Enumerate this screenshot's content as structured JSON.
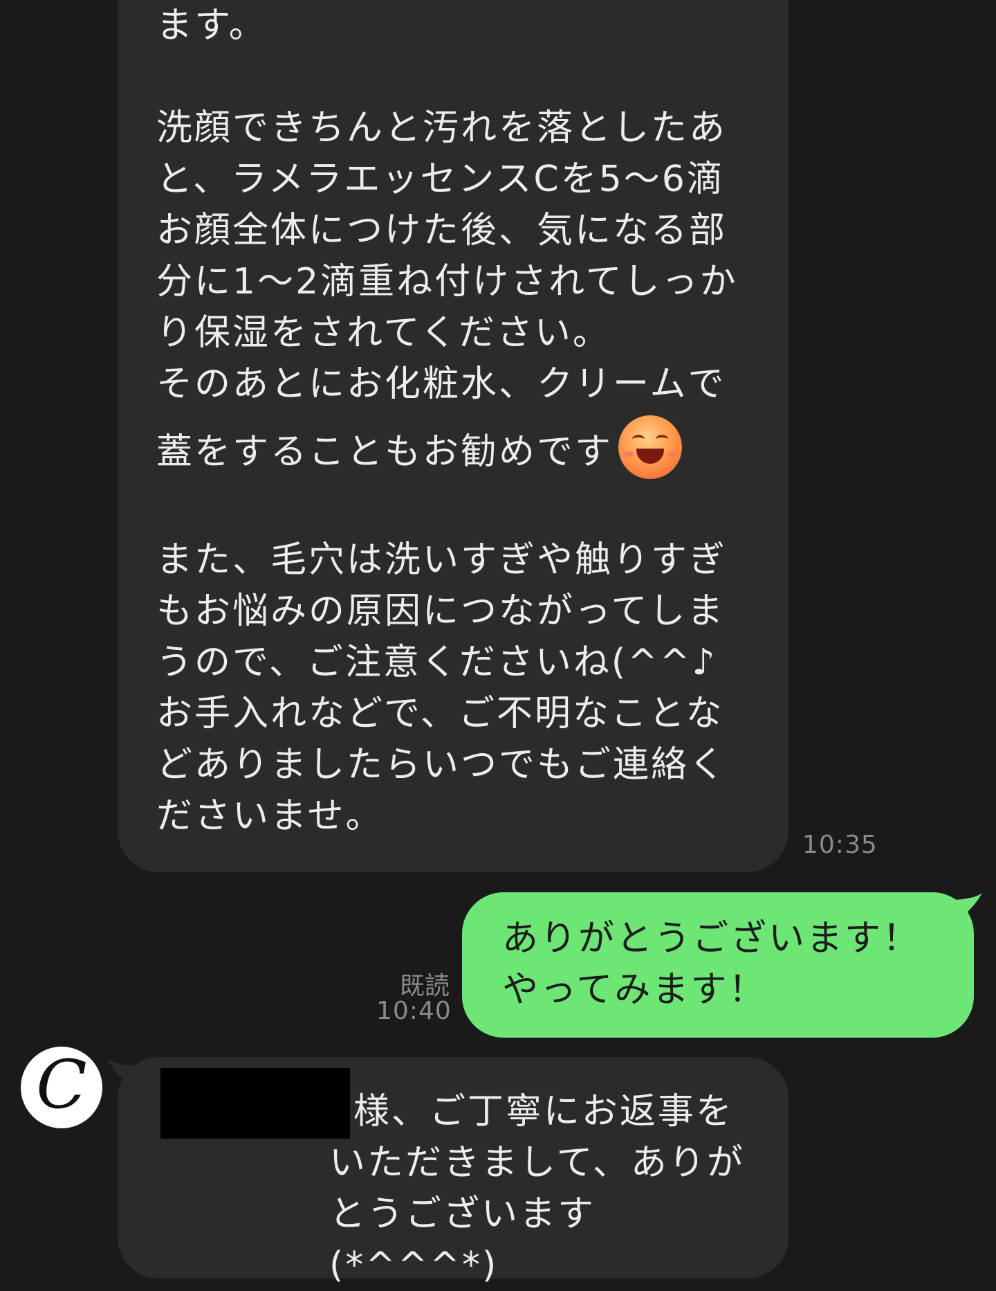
{
  "messages": [
    {
      "side": "in",
      "paragraphs": [
        "ます。",
        "洗顔できちんと汚れを落としたあと、ラメラエッセンスCを5〜6滴お顔全体につけた後、気になる部分に1〜2滴重ね付けされてしっかり保湿をされてください。\nそのあとにお化粧水、クリームで",
        "蓋をすることもお勧めです",
        "また、毛穴は洗いすぎや触りすぎもお悩みの原因につながってしまうので、ご注意くださいね(^^♪\nお手入れなどで、ご不明なことなどありましたらいつでもご連絡くださいませ。"
      ],
      "emoji": "smiling-face-emoji",
      "time": "10:35"
    },
    {
      "side": "out",
      "text": "ありがとうございます！\nやってみます！",
      "read_status": "既読",
      "time": "10:40"
    },
    {
      "side": "in",
      "text": "o様、ご丁寧にお返事をいただきまして、ありがとうございます(*^^^*)",
      "avatar_letter": "C"
    }
  ],
  "colors": {
    "background": "#1a1a1a",
    "incoming_bubble": "#2b2b2b",
    "outgoing_bubble": "#6ee676",
    "text_light": "#ededed",
    "meta_text": "#8a8a8a"
  }
}
